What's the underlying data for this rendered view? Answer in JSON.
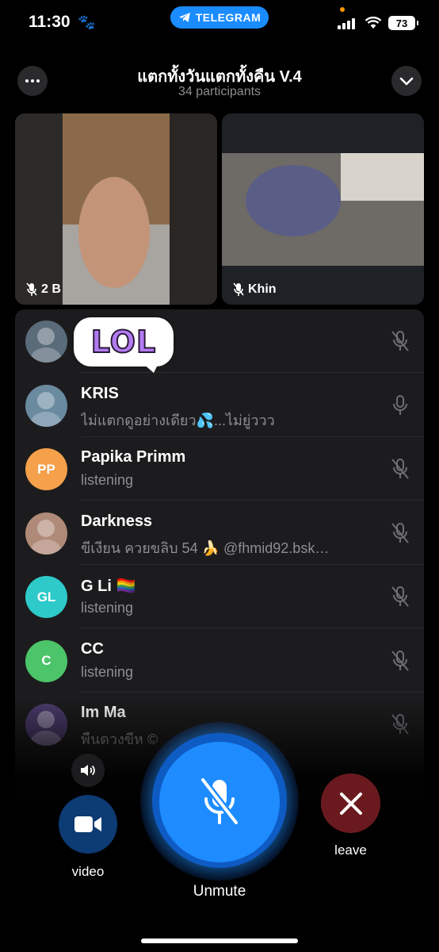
{
  "status_bar": {
    "time": "11:30",
    "pill_label": "TELEGRAM",
    "battery": "73"
  },
  "header": {
    "title": "แตกทั้งวันแตกทั้งคืน V.4",
    "participants": "34 participants"
  },
  "videos": [
    {
      "name": "2 B"
    },
    {
      "name": "Khin"
    }
  ],
  "sticker": {
    "text": "LOL"
  },
  "participants": [
    {
      "name": "",
      "status": "",
      "avatar_initials": "",
      "avatar_color": "#5a6b7a"
    },
    {
      "name": "KRIS",
      "status": "ไม่แตกดูอย่างเดียว💦...ไม่ยู่ววว",
      "avatar_initials": "",
      "avatar_color": "#6a8aa0"
    },
    {
      "name": "Papika Primm",
      "status": "listening",
      "avatar_initials": "PP",
      "avatar_color": "#f5a04a"
    },
    {
      "name": "Darkness",
      "status": "ขีเงียน ควยขลิบ 54 🍌 @fhmid92.bsk…",
      "avatar_initials": "",
      "avatar_color": "#b08a78"
    },
    {
      "name": "G Li 🏳️‍🌈",
      "status": "listening",
      "avatar_initials": "GL",
      "avatar_color": "#2ec9c9"
    },
    {
      "name": "CC",
      "status": "listening",
      "avatar_initials": "C",
      "avatar_color": "#4cc46a"
    },
    {
      "name": "Im Ma",
      "status": "พืนดวงขีห ©",
      "avatar_initials": "",
      "avatar_color": "#4a3a6a"
    }
  ],
  "controls": {
    "video": "video",
    "unmute": "Unmute",
    "leave": "leave"
  },
  "colors": {
    "accent": "#1a8cff",
    "leave": "#6a1a1e",
    "video_btn": "#0d3b73"
  }
}
